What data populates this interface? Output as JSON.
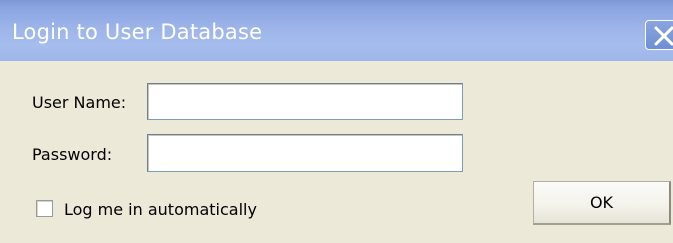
{
  "window": {
    "title": "Login to User Database"
  },
  "titlebar": {
    "close_icon": "close-x-icon"
  },
  "form": {
    "username_label": "User Name:",
    "username_value": "",
    "password_label": "Password:",
    "password_value": "",
    "auto_login_label": "Log me in automatically",
    "auto_login_checked": false,
    "ok_label": "OK"
  },
  "colors": {
    "titlebar": "#9db4ea",
    "window_background": "#ece9d8",
    "input_border": "#7f9db9"
  }
}
